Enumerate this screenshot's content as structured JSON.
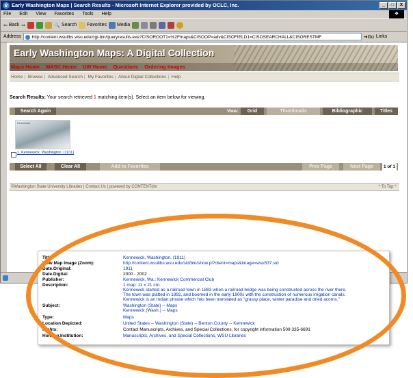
{
  "window": {
    "title": "Early Washington Maps | Search Results - Microsoft Internet Explorer provided by OCLC, Inc.",
    "controls": [
      "_",
      "□",
      "X"
    ]
  },
  "menu": [
    "File",
    "Edit",
    "View",
    "Favorites",
    "Tools",
    "Help"
  ],
  "toolbar": {
    "back": "Back",
    "search": "Search",
    "favorites": "Favorites",
    "media": "Media"
  },
  "addressbar": {
    "label": "Address",
    "url": "http://content.wsulibs.wsu.edu/cgi-bin/queryresults.exe?CISOROOT1=%2Fmaps&CISOOP=adv&CISOFIELD1=CISOSEARCHALL&CISORESTMF",
    "go": "Go",
    "links": "Links"
  },
  "banner": {
    "title": "Early Washington Maps: A Digital Collection",
    "nav": [
      "Maps Home",
      "MASC Home",
      "UW Home",
      "Questions",
      "Ordering Images"
    ]
  },
  "subnav": [
    "Home",
    "Browse",
    "Advanced Search",
    "My Favorites",
    "About Digital Collections",
    "Help"
  ],
  "results": {
    "prefix": "Search Results:",
    "text_before": "Your search retrieved",
    "count": "1",
    "text_after": "matching item(s). Select an item below for viewing."
  },
  "viewbar": {
    "search_again": "Search Again",
    "view_label": "View:",
    "views": [
      "Grid",
      "Thumbnails",
      "Bibliographic",
      "Titles"
    ]
  },
  "item": {
    "thumb_label": "Kennewick",
    "link": "1. Kennewick, Washington. (1911)"
  },
  "actionbar": {
    "select_all": "Select All",
    "clear_all": "Clear All",
    "add_favorites": "Add to Favorites",
    "prev": "Prev Page",
    "next": "Next Page",
    "page": "1 of 1"
  },
  "footer": {
    "text": "©Washington State University Libraries | Contact Us | powered by CONTENTdm",
    "top": "^ To Top ^"
  },
  "metadata": [
    {
      "label": "Title:",
      "value": "Kennewick, Washington. (1911)"
    },
    {
      "label": "View Map Image (Zoom):",
      "value": "http://content.wsulibs.wsu.edu/sid/bin/show.pl?client=maps&image=wsu537.sid"
    },
    {
      "label": "Date.Original:",
      "value": "1911"
    },
    {
      "label": "Date.Digital:",
      "value": "2000 - 2002",
      "plain": true
    },
    {
      "label": "Publisher:",
      "value": "Kennewick, Wa.: Kennewick Commercial Club"
    },
    {
      "label": "Description:",
      "value": "1 map: 11 x 21 cm."
    },
    {
      "label": "",
      "value": "Kennewick started as a railroad town in 1883 when a railroad bridge was being constructed across the river there."
    },
    {
      "label": "",
      "value": "The town was platted in 1892, and boomed in the early 1900s with the construction of numerous irrigation canals."
    },
    {
      "label": "",
      "value": "Kennewick is an Indian phrase which has been translated as \"grassy place, winter paradise and dried acorns.\""
    },
    {
      "label": "Subject:",
      "value": "Washington (State) -- Maps"
    },
    {
      "label": "",
      "value": "Kennewick (Wash.) -- Maps"
    },
    {
      "label": "Type:",
      "value": "Maps"
    },
    {
      "label": "Location Depicted:",
      "value": "United States -- Washington (State) -- Benton County -- Kennewick"
    },
    {
      "label": "Rights:",
      "value": "Contact Manuscripts, Archives, and Special Collections, for copyright information 509 335-6691",
      "plain": true
    },
    {
      "label": "Holding.Institution:",
      "value": "Manuscripts, Archives, and Special Collections, WSU Libraries"
    }
  ],
  "colors": {
    "accent_red": "#cc0000",
    "link_blue": "#0033aa",
    "highlight_orange": "#f08a24",
    "bar_tan": "#9a907c"
  }
}
